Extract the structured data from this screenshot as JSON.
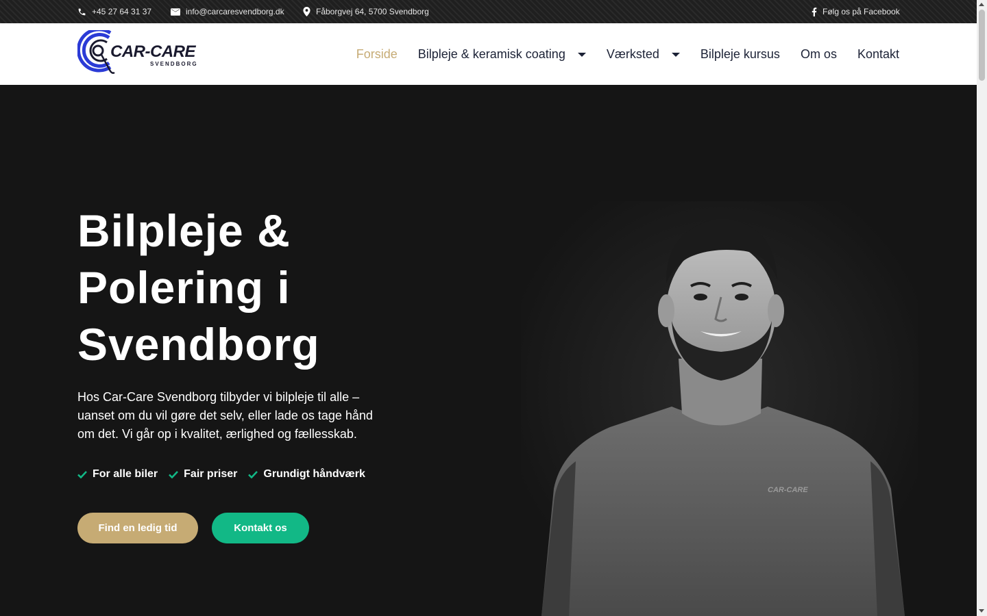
{
  "topbar": {
    "phone": "+45 27 64 31 37",
    "email": "info@carcaresvendborg.dk",
    "address": "Fåborgvej 64, 5700 Svendborg",
    "facebook": "Følg os på Facebook"
  },
  "logo": {
    "name": "CAR-CARE",
    "sub": "SVENDBORG"
  },
  "nav": [
    {
      "label": "Forside",
      "active": true
    },
    {
      "label": "Bilpleje & keramisk coating",
      "dropdown": true
    },
    {
      "label": "Værksted",
      "dropdown": true
    },
    {
      "label": "Bilpleje kursus"
    },
    {
      "label": "Om os"
    },
    {
      "label": "Kontakt"
    }
  ],
  "hero": {
    "title": "Bilpleje & Polering i Svendborg",
    "text": "Hos Car-Care Svendborg tilbyder vi bilpleje til alle – uanset om du vil gøre det selv, eller lade os tage hånd om det. Vi går op i kvalitet, ærlighed og fællesskab.",
    "features": [
      "For alle biler",
      "Fair priser",
      "Grundigt håndværk"
    ],
    "primary_button": "Find en ledig tid",
    "secondary_button": "Kontakt os",
    "shirt_logo": "CAR-CARE"
  },
  "colors": {
    "accent_gold": "#c6ab74",
    "accent_green": "#12b886",
    "nav_text": "#1c2236",
    "hero_bg": "#151515"
  },
  "icons": {
    "phone": "phone-icon",
    "email": "envelope-icon",
    "address": "map-pin-icon",
    "facebook": "facebook-icon",
    "feature": "check-icon",
    "dropdown": "caret-down-icon"
  }
}
